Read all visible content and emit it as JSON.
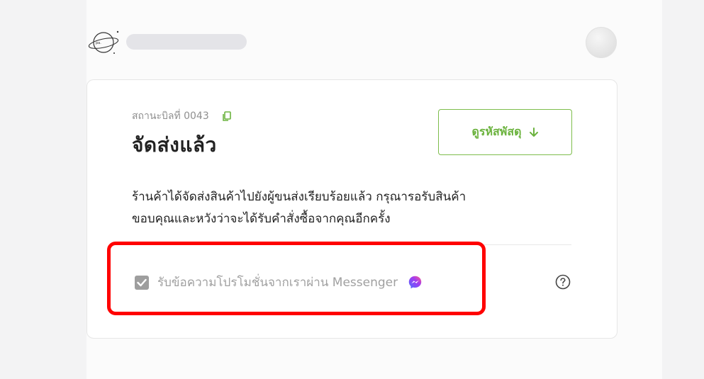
{
  "header": {
    "logo_icon": "planet-logo-icon",
    "avatar_icon": "user-avatar"
  },
  "order": {
    "bill_label": "สถานะบิลที่ 0043",
    "copy_icon": "copy-icon",
    "status_title": "จัดส่งแล้ว",
    "track_button_label": "ดูรหัสพัสดุ",
    "track_button_icon": "arrow-down-icon",
    "description_line1": "ร้านค้าได้จัดส่งสินค้าไปยังผู้ขนส่งเรียบร้อยแล้ว กรุณารอรับสินค้า",
    "description_line2": "ขอบคุณและหวังว่าจะได้รับคำสั่งซื้อจากคุณอีกครั้ง"
  },
  "optin": {
    "checked": true,
    "label": "รับข้อความโปรโมชั่นจากเราผ่าน Messenger",
    "messenger_icon": "messenger-icon",
    "help_icon": "help-icon"
  },
  "colors": {
    "accent_green": "#6cb33f",
    "highlight_red": "#ff0000",
    "messenger_blue": "#4c6bff",
    "messenger_purple": "#a33cf0"
  }
}
